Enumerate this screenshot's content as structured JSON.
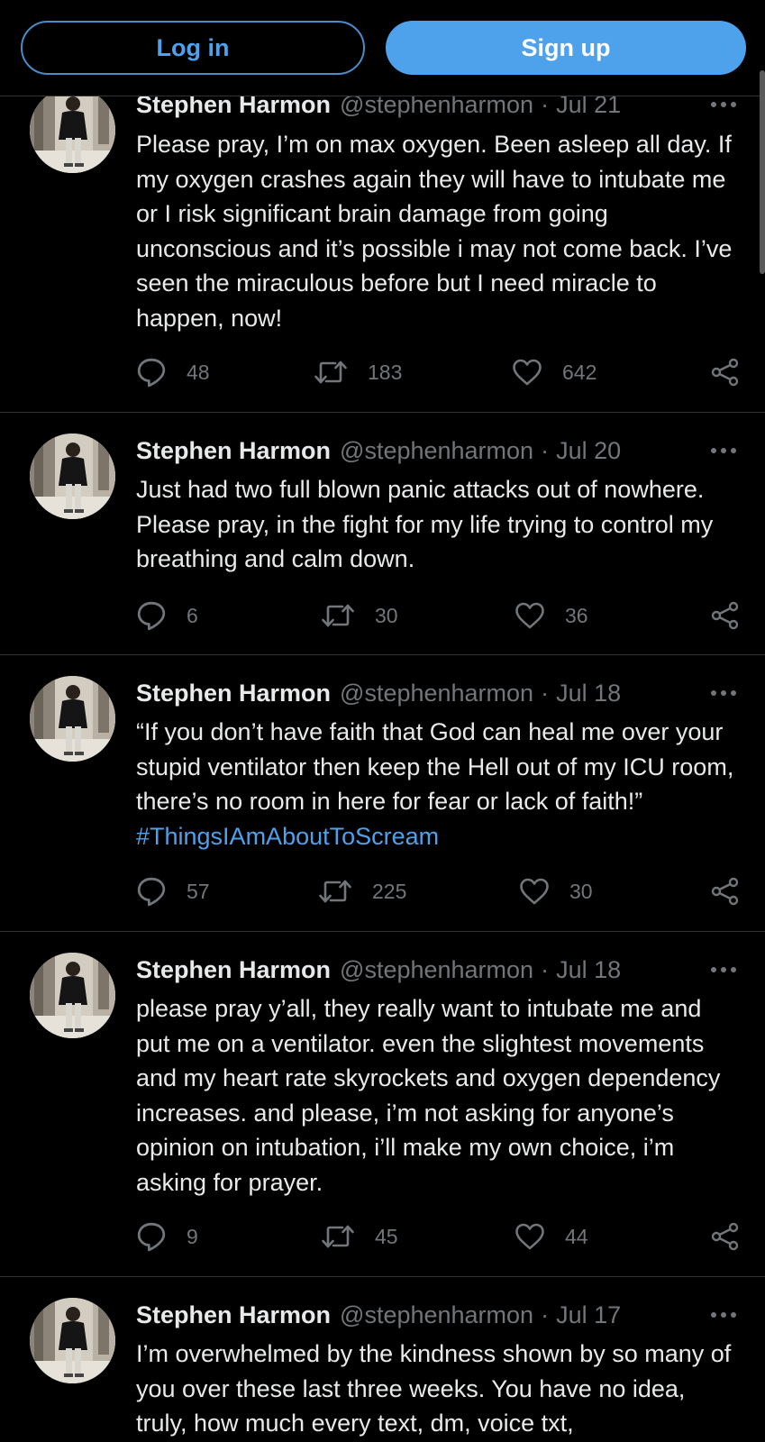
{
  "auth": {
    "login_label": "Log in",
    "signup_label": "Sign up"
  },
  "author": {
    "name": "Stephen Harmon",
    "handle": "@stephenharmon"
  },
  "tweets": [
    {
      "date": "Jul 21",
      "text": "Please pray, I’m on max oxygen. Been asleep all day. If my oxygen crashes again they will have to intubate me or I risk significant brain damage from going unconscious and it’s possible i may not come back. I’ve seen the miraculous before but I need miracle to happen, now!",
      "hashtag": "",
      "replies": "48",
      "retweets": "183",
      "likes": "642"
    },
    {
      "date": "Jul 20",
      "text": "Just had two full blown panic attacks out of nowhere. Please pray, in the fight for my life trying to control my breathing and calm down.",
      "hashtag": "",
      "replies": "6",
      "retweets": "30",
      "likes": "36"
    },
    {
      "date": "Jul 18",
      "text": "“If you don’t have faith that God can heal me over your stupid ventilator then keep the Hell out of my ICU room, there’s no room in here for fear or lack of faith!”",
      "hashtag": "#ThingsIAmAboutToScream",
      "replies": "57",
      "retweets": "225",
      "likes": "30"
    },
    {
      "date": "Jul 18",
      "text": "please pray y’all, they really want to intubate me and put me on a ventilator. even the slightest movements and my heart rate skyrockets and oxygen dependency increases. and please, i’m not asking for anyone’s opinion on intubation, i’ll make my own choice, i’m asking for prayer.",
      "hashtag": "",
      "replies": "9",
      "retweets": "45",
      "likes": "44"
    },
    {
      "date": "Jul 17",
      "text": "I’m overwhelmed by the kindness shown by so many of you over these last three weeks. You have no idea, truly, how much every text, dm, voice txt,",
      "hashtag": "",
      "replies": "",
      "retweets": "",
      "likes": ""
    }
  ],
  "colors": {
    "background": "#000000",
    "accent": "#4ea1eb",
    "muted_text": "#71767b",
    "primary_text": "#e7e9ea",
    "divider": "#2f3336"
  },
  "icons": {
    "more": "more-horizontal-icon",
    "reply": "reply-bubble-icon",
    "retweet": "retweet-icon",
    "like": "heart-icon",
    "share": "share-icon"
  }
}
